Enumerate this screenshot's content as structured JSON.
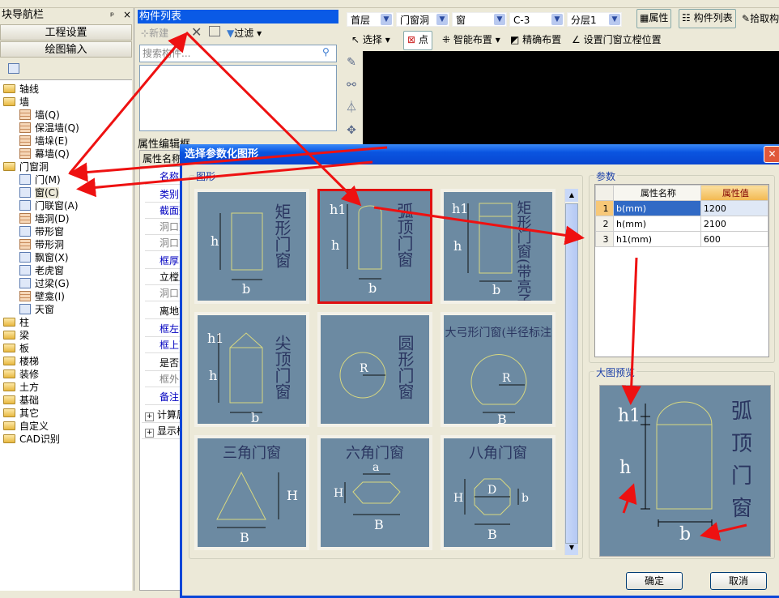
{
  "nav": {
    "title": "块导航栏",
    "btn_setup": "工程设置",
    "btn_draw": "绘图输入",
    "tree": [
      {
        "label": "轴线",
        "type": "folder",
        "lvl": 0
      },
      {
        "label": "墙",
        "type": "folder",
        "lvl": 0
      },
      {
        "label": "墙(Q)",
        "type": "wall",
        "lvl": 1
      },
      {
        "label": "保温墙(Q)",
        "type": "wall",
        "lvl": 1
      },
      {
        "label": "墙垛(E)",
        "type": "wall",
        "lvl": 1
      },
      {
        "label": "幕墙(Q)",
        "type": "wall",
        "lvl": 1
      },
      {
        "label": "门窗洞",
        "type": "folder",
        "lvl": 0
      },
      {
        "label": "门(M)",
        "type": "item",
        "lvl": 1
      },
      {
        "label": "窗(C)",
        "type": "item",
        "lvl": 1,
        "selected": true
      },
      {
        "label": "门联窗(A)",
        "type": "item",
        "lvl": 1
      },
      {
        "label": "墙洞(D)",
        "type": "wall",
        "lvl": 1
      },
      {
        "label": "带形窗",
        "type": "item",
        "lvl": 1
      },
      {
        "label": "带形洞",
        "type": "wall",
        "lvl": 1
      },
      {
        "label": "飘窗(X)",
        "type": "item",
        "lvl": 1
      },
      {
        "label": "老虎窗",
        "type": "item",
        "lvl": 1
      },
      {
        "label": "过梁(G)",
        "type": "item",
        "lvl": 1
      },
      {
        "label": "壁龛(I)",
        "type": "wall",
        "lvl": 1
      },
      {
        "label": "天窗",
        "type": "item",
        "lvl": 1
      },
      {
        "label": "柱",
        "type": "folder",
        "lvl": 0
      },
      {
        "label": "梁",
        "type": "folder",
        "lvl": 0
      },
      {
        "label": "板",
        "type": "folder",
        "lvl": 0
      },
      {
        "label": "楼梯",
        "type": "folder",
        "lvl": 0
      },
      {
        "label": "装修",
        "type": "folder",
        "lvl": 0
      },
      {
        "label": "土方",
        "type": "folder",
        "lvl": 0
      },
      {
        "label": "基础",
        "type": "folder",
        "lvl": 0
      },
      {
        "label": "其它",
        "type": "folder",
        "lvl": 0
      },
      {
        "label": "自定义",
        "type": "folder",
        "lvl": 0
      },
      {
        "label": "CAD识别",
        "type": "folder",
        "lvl": 0
      }
    ]
  },
  "components": {
    "title": "构件列表",
    "new": "新建",
    "filter": "过滤",
    "search_placeholder": "搜索构件...",
    "prop_title": "属性编辑框",
    "prop_header": "属性名称",
    "props": [
      {
        "l": "名称",
        "c": "#0000c0"
      },
      {
        "l": "类别",
        "c": "#0000c0"
      },
      {
        "l": "截面形",
        "c": "#0000c0"
      },
      {
        "l": "洞口宽",
        "c": "#808080"
      },
      {
        "l": "洞口高",
        "c": "#808080"
      },
      {
        "l": "框厚",
        "c": "#0000c0"
      },
      {
        "l": "立樘距",
        "c": "#000"
      },
      {
        "l": "洞口面",
        "c": "#808080"
      },
      {
        "l": "离地高",
        "c": "#000"
      },
      {
        "l": "框左右",
        "c": "#0000c0"
      },
      {
        "l": "框上下",
        "c": "#0000c0"
      },
      {
        "l": "是否随",
        "c": "#000"
      },
      {
        "l": "框外围",
        "c": "#808080"
      },
      {
        "l": "备注",
        "c": "#0000c0"
      }
    ],
    "groups": [
      "计算属",
      "显示样"
    ]
  },
  "toolbar": {
    "floor": "首层",
    "category": "门窗洞",
    "type": "窗",
    "name": "C-3",
    "layer": "分层1",
    "attr": "属性",
    "complist": "构件列表",
    "pick": "拾取构",
    "select": "选择",
    "point": "点",
    "smart": "智能布置",
    "precise": "精确布置",
    "setpos": "设置门窗立樘位置"
  },
  "dialog": {
    "title": "选择参数化图形",
    "shapes_label": "图形",
    "params_label": "参数",
    "preview_label": "大图预览",
    "ok": "确定",
    "cancel": "取消",
    "param_headers": [
      "属性名称",
      "属性值"
    ],
    "params": [
      {
        "n": "1",
        "name": "b(mm)",
        "value": "1200"
      },
      {
        "n": "2",
        "name": "h(mm)",
        "value": "2100"
      },
      {
        "n": "3",
        "name": "h1(mm)",
        "value": "600"
      }
    ],
    "shapes": [
      "矩形门窗",
      "弧顶门窗",
      "矩形门窗(带亮子)",
      "尖顶门窗",
      "圆形门窗",
      "大弓形门窗(半径标注)",
      "三角门窗",
      "六角门窗",
      "八角门窗"
    ],
    "selected_shape": "弧顶门窗",
    "labels": {
      "h": "h",
      "b": "b",
      "h1": "h1",
      "R": "R",
      "H": "H",
      "B": "B",
      "a": "a",
      "D": "D"
    },
    "preview_title": "弧顶门窗"
  },
  "colors": {
    "annotation": "#ee1111",
    "selection": "#e01010",
    "tile": "#6c8aa2",
    "title_bar": "#0a54e0"
  }
}
